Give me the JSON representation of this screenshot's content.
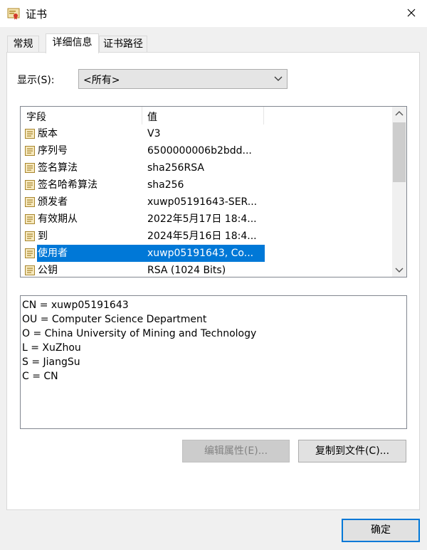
{
  "window": {
    "title": "证书",
    "icon": "certificate-icon",
    "close_icon": "close-icon"
  },
  "tabs": [
    {
      "label": "常规",
      "active": false
    },
    {
      "label": "详细信息",
      "active": true
    },
    {
      "label": "证书路径",
      "active": false
    }
  ],
  "show": {
    "label": "显示(S):",
    "selected": "<所有>"
  },
  "fields_list": {
    "headers": {
      "field": "字段",
      "value": "值"
    },
    "rows": [
      {
        "field": "版本",
        "value": "V3",
        "selected": false
      },
      {
        "field": "序列号",
        "value": "6500000006b2bdd...",
        "selected": false
      },
      {
        "field": "签名算法",
        "value": "sha256RSA",
        "selected": false
      },
      {
        "field": "签名哈希算法",
        "value": "sha256",
        "selected": false
      },
      {
        "field": "颁发者",
        "value": "xuwp05191643-SER...",
        "selected": false
      },
      {
        "field": "有效期从",
        "value": "2022年5月17日 18:4...",
        "selected": false
      },
      {
        "field": "到",
        "value": "2024年5月16日 18:4...",
        "selected": false
      },
      {
        "field": "使用者",
        "value": "xuwp05191643, Co...",
        "selected": true
      },
      {
        "field": "公钥",
        "value": "RSA (1024 Bits)",
        "selected": false
      }
    ]
  },
  "detail_lines": [
    "CN = xuwp05191643",
    "OU = Computer Science Department",
    "O = China University of Mining and Technology",
    "L = XuZhou",
    "S = JiangSu",
    "C = CN"
  ],
  "buttons": {
    "edit_properties": "编辑属性(E)...",
    "copy_to_file": "复制到文件(C)...",
    "ok": "确定"
  },
  "colors": {
    "selection": "#0078d7",
    "ok_border": "#0078d7"
  }
}
